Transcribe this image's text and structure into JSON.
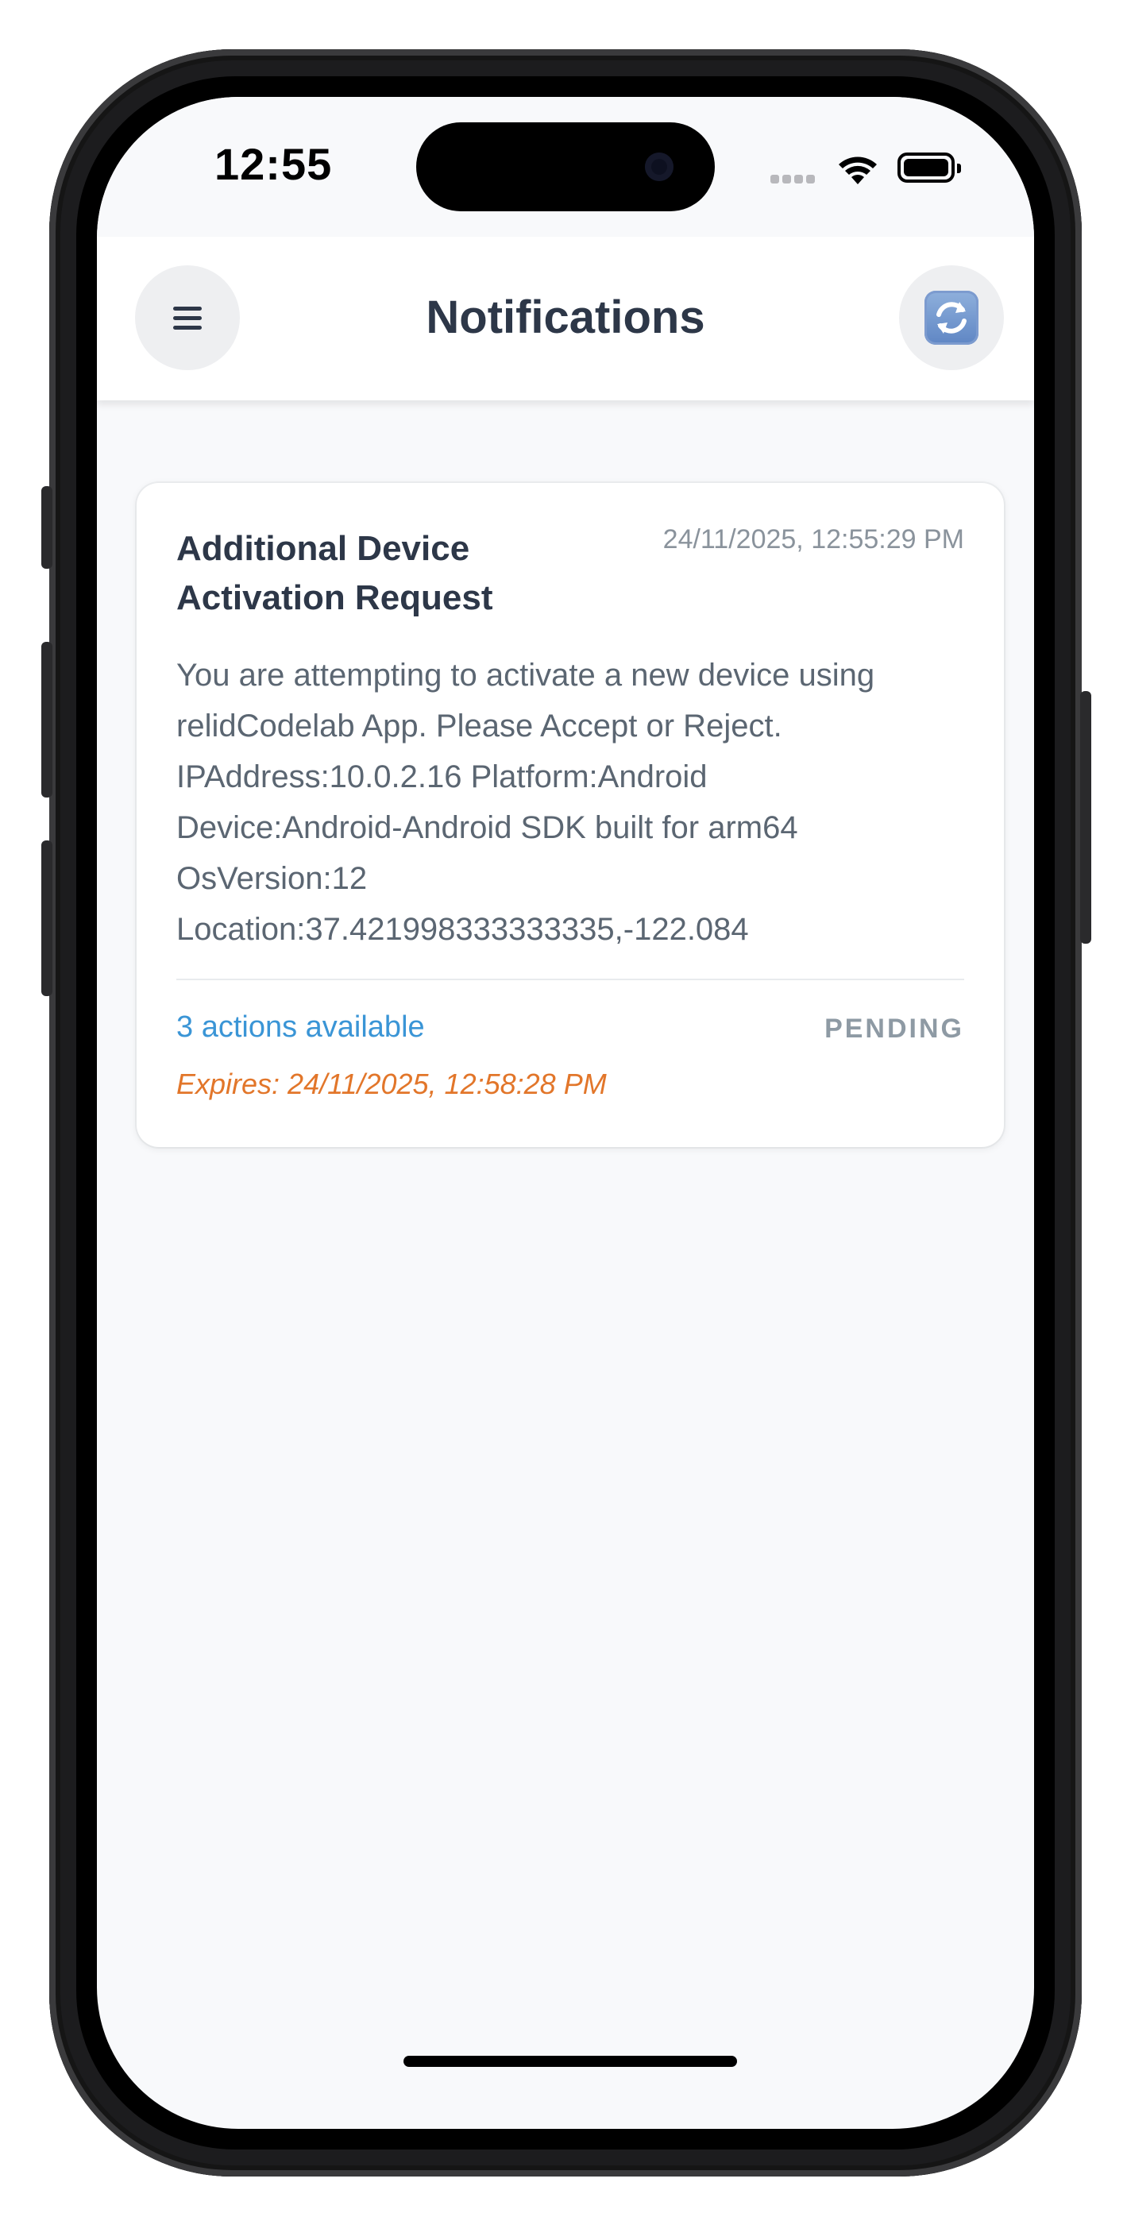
{
  "status_bar": {
    "time": "12:55"
  },
  "header": {
    "title": "Notifications",
    "menu_icon": "hamburger-menu-icon",
    "refresh_icon": "refresh-icon"
  },
  "notification": {
    "title": "Additional Device Activation Request",
    "timestamp": "24/11/2025, 12:55:29 PM",
    "body_lines": [
      "You are attempting to activate a new device using",
      "relidCodelab App. Please Accept or Reject.",
      "IPAddress:10.0.2.16 Platform:Android",
      "Device:Android-Android SDK built for arm64",
      "OsVersion:12",
      "Location:37.421998333333335,-122.084"
    ],
    "actions_label": "3 actions available",
    "status": "PENDING",
    "expires": "Expires: 24/11/2025, 12:58:28 PM"
  },
  "colors": {
    "accent_blue": "#3a95d6",
    "expires_orange": "#e2762a",
    "title_dark": "#2d3748",
    "status_gray": "#8e9aa4"
  }
}
